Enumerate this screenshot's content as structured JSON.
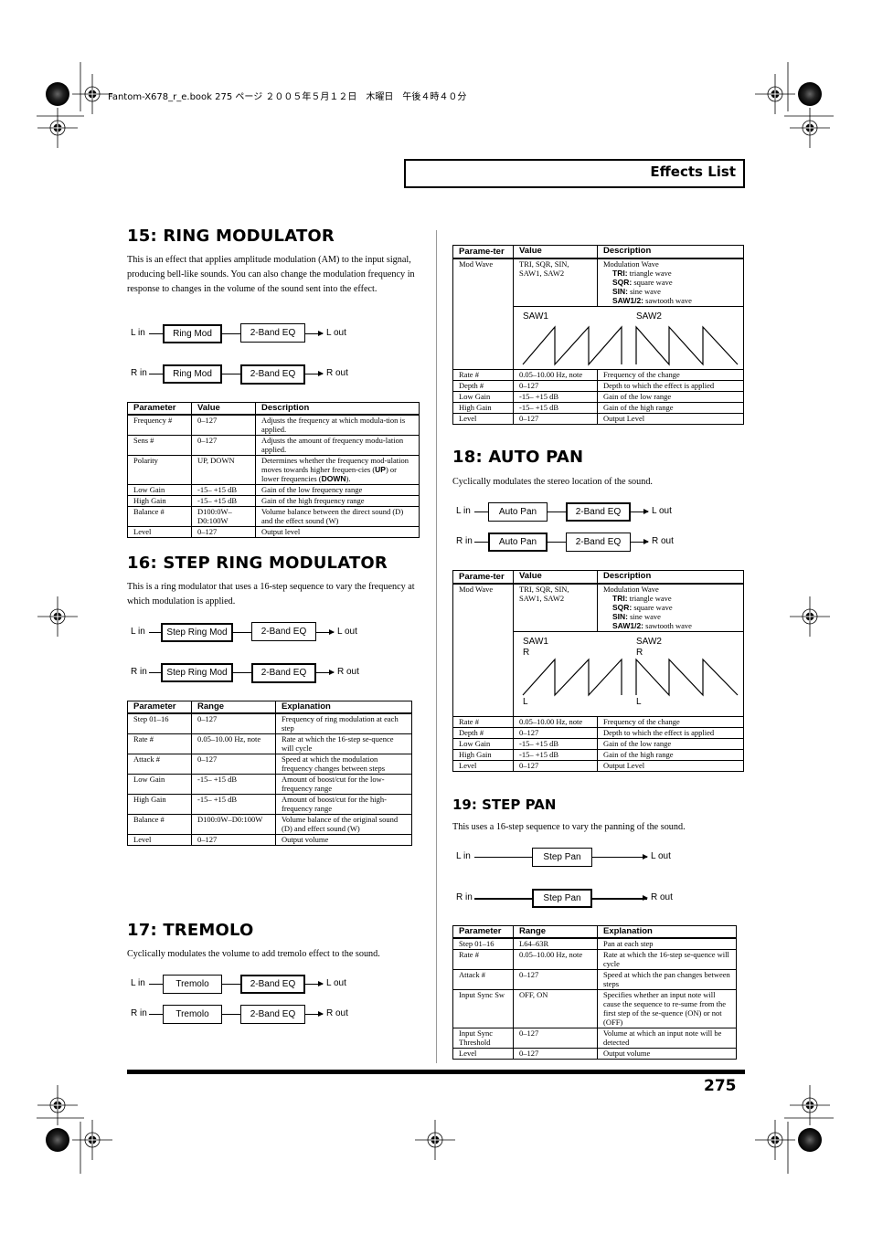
{
  "header": {
    "print_line": "Fantom-X678_r_e.book  275 ページ  ２００５年５月１２日　木曜日　午後４時４０分",
    "section_title": "Effects List"
  },
  "footer": {
    "page_number": "275"
  },
  "ring_modulator": {
    "title": "15: RING MODULATOR",
    "intro": "This is an effect that applies amplitude modulation (AM) to the input signal, producing bell-like sounds. You can also change the modulation frequency in response to changes in the volume of the sound sent into the effect.",
    "diagram": {
      "l_in": "L in",
      "r_in": "R in",
      "l_out": "L out",
      "r_out": "R out",
      "block1": "Ring Mod",
      "block2": "2-Band EQ"
    },
    "table": {
      "headers": [
        "Parameter",
        "Value",
        "Description"
      ],
      "rows": [
        [
          "Frequency #",
          "0–127",
          "Adjusts the frequency at which modula-tion is applied."
        ],
        [
          "Sens #",
          "0–127",
          "Adjusts the amount of frequency modu-lation applied."
        ],
        [
          "Polarity",
          "UP, DOWN",
          "Determines whether the frequency mod-ulation moves towards higher frequen-cies (UP) or lower frequencies (DOWN)."
        ],
        [
          "Low Gain",
          "-15– +15 dB",
          "Gain of the low frequency range"
        ],
        [
          "High Gain",
          "-15– +15 dB",
          "Gain of the high frequency range"
        ],
        [
          "Balance #",
          "D100:0W–D0:100W",
          "Volume balance between the direct sound (D) and the effect sound (W)"
        ],
        [
          "Level",
          "0–127",
          "Output level"
        ]
      ]
    }
  },
  "step_ring_modulator": {
    "title": "16: STEP RING MODULATOR",
    "intro": "This is a ring modulator that uses a 16-step sequence to vary the frequency at which modulation is applied.",
    "diagram": {
      "l_in": "L in",
      "r_in": "R in",
      "l_out": "L out",
      "r_out": "R out",
      "block1": "Step Ring Mod",
      "block2": "2-Band EQ"
    },
    "table": {
      "headers": [
        "Parameter",
        "Range",
        "Explanation"
      ],
      "rows": [
        [
          "Step 01–16",
          "0–127",
          "Frequency of ring modulation at each step"
        ],
        [
          "Rate #",
          "0.05–10.00 Hz, note",
          "Rate at which the 16-step se-quence will cycle"
        ],
        [
          "Attack #",
          "0–127",
          "Speed at which the modulation frequency changes between steps"
        ],
        [
          "Low Gain",
          "-15– +15 dB",
          "Amount of boost/cut for the low-frequency range"
        ],
        [
          "High Gain",
          "-15– +15 dB",
          "Amount of boost/cut for the high-frequency range"
        ],
        [
          "Balance #",
          "D100:0W–D0:100W",
          "Volume balance of the original sound (D) and effect sound (W)"
        ],
        [
          "Level",
          "0–127",
          "Output volume"
        ]
      ]
    }
  },
  "tremolo": {
    "title": "17: TREMOLO",
    "intro": "Cyclically modulates the volume to add tremolo effect to the sound.",
    "diagram": {
      "l_in": "L in",
      "r_in": "R in",
      "l_out": "L out",
      "r_out": "R out",
      "block1": "Tremolo",
      "block2": "2-Band EQ"
    },
    "table": {
      "headers": [
        "Parame-ter",
        "Value",
        "Description"
      ],
      "mod_wave": {
        "param": "Mod Wave",
        "value": "TRI, SQR, SIN, SAW1, SAW2",
        "desc_title": "Modulation Wave",
        "waves": [
          {
            "key": "TRI:",
            "text": "triangle wave"
          },
          {
            "key": "SQR:",
            "text": "square wave"
          },
          {
            "key": "SIN:",
            "text": "sine wave"
          },
          {
            "key": "SAW1/2:",
            "text": "sawtooth wave"
          }
        ],
        "saw1_label": "SAW1",
        "saw2_label": "SAW2"
      },
      "rows": [
        [
          "Rate #",
          "0.05–10.00 Hz, note",
          "Frequency of the change"
        ],
        [
          "Depth #",
          "0–127",
          "Depth to which the effect is applied"
        ],
        [
          "Low Gain",
          "-15– +15 dB",
          "Gain of the low range"
        ],
        [
          "High Gain",
          "-15– +15 dB",
          "Gain of the high range"
        ],
        [
          "Level",
          "0–127",
          "Output Level"
        ]
      ]
    }
  },
  "auto_pan": {
    "title": "18: AUTO PAN",
    "intro": "Cyclically modulates the stereo location of the sound.",
    "diagram": {
      "l_in": "L in",
      "r_in": "R in",
      "l_out": "L out",
      "r_out": "R out",
      "block1": "Auto Pan",
      "block2": "2-Band EQ"
    },
    "table": {
      "headers": [
        "Parame-ter",
        "Value",
        "Description"
      ],
      "mod_wave": {
        "param": "Mod Wave",
        "value": "TRI, SQR, SIN, SAW1, SAW2",
        "desc_title": "Modulation Wave",
        "waves": [
          {
            "key": "TRI:",
            "text": "triangle wave"
          },
          {
            "key": "SQR:",
            "text": "square wave"
          },
          {
            "key": "SIN:",
            "text": "sine wave"
          },
          {
            "key": "SAW1/2:",
            "text": "sawtooth wave"
          }
        ],
        "saw1_label": "SAW1",
        "saw2_label": "SAW2",
        "r_label": "R",
        "l_label": "L"
      },
      "rows": [
        [
          "Rate #",
          "0.05–10.00 Hz, note",
          "Frequency of the change"
        ],
        [
          "Depth #",
          "0–127",
          "Depth to which the effect is applied"
        ],
        [
          "Low Gain",
          "-15– +15 dB",
          "Gain of the low range"
        ],
        [
          "High Gain",
          "-15– +15 dB",
          "Gain of the high range"
        ],
        [
          "Level",
          "0–127",
          "Output Level"
        ]
      ]
    }
  },
  "step_pan": {
    "title": "19: STEP PAN",
    "intro": "This uses a 16-step sequence to vary the panning of the sound.",
    "diagram": {
      "l_in": "L in",
      "r_in": "R in",
      "l_out": "L out",
      "r_out": "R out",
      "block1": "Step Pan"
    },
    "table": {
      "headers": [
        "Parameter",
        "Range",
        "Explanation"
      ],
      "rows": [
        [
          "Step 01–16",
          "L64–63R",
          "Pan at each step"
        ],
        [
          "Rate #",
          "0.05–10.00 Hz, note",
          "Rate at which the 16-step se-quence will cycle"
        ],
        [
          "Attack #",
          "0–127",
          "Speed at which the pan changes between steps"
        ],
        [
          "Input Sync Sw",
          "OFF, ON",
          "Specifies whether an input note will cause the sequence to re-sume from the first step of the se-quence (ON) or not (OFF)"
        ],
        [
          "Input Sync Threshold",
          "0–127",
          "Volume at which an input note will be detected"
        ],
        [
          "Level",
          "0–127",
          "Output volume"
        ]
      ]
    }
  }
}
